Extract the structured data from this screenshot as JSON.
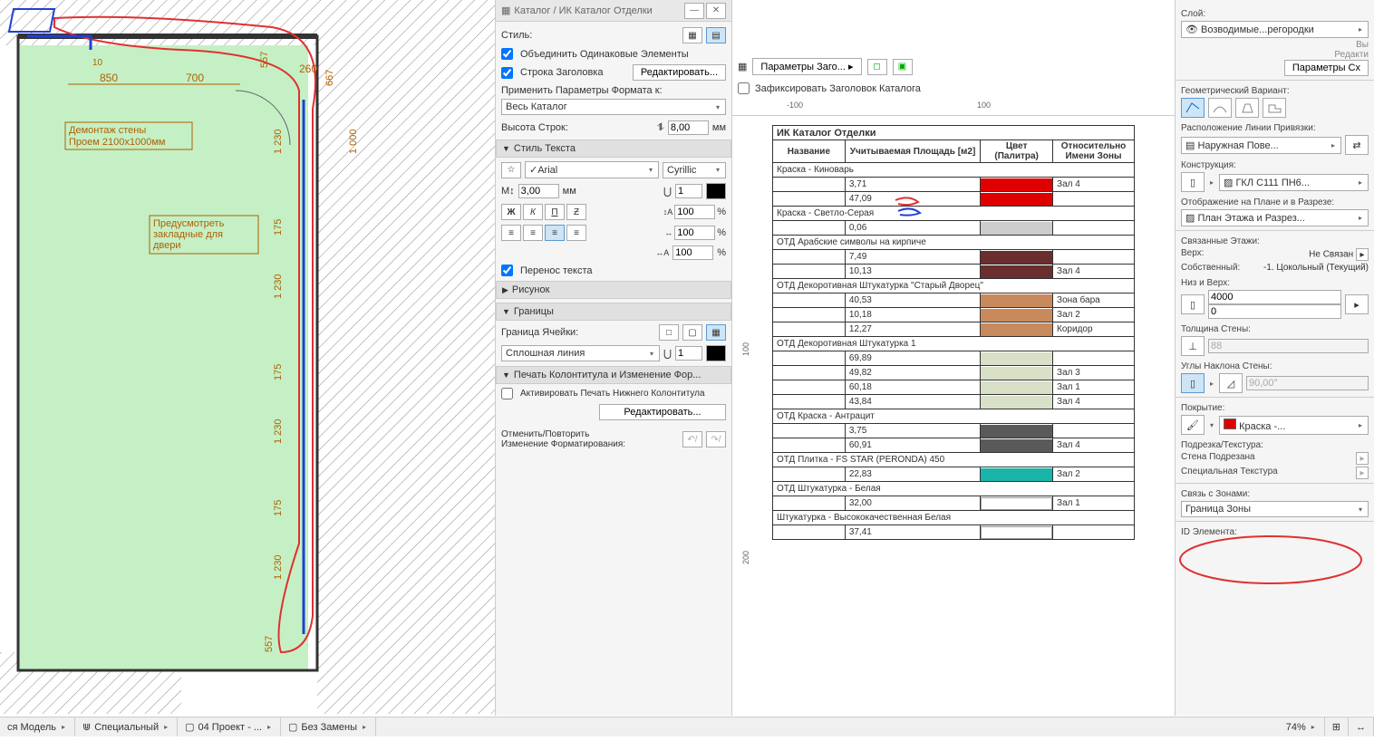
{
  "plan": {
    "note1_line1": "Демонтаж стены",
    "note1_line2": "Проем 2100х1000мм",
    "note2_line1": "Предусмотреть",
    "note2_line2": "закладные для",
    "note2_line3": "двери",
    "dims": {
      "d850": "850",
      "d700": "700",
      "d260": "260",
      "d10": "10",
      "d557": "557",
      "d667": "667",
      "d1000": "1 000",
      "d1230": "1 230",
      "d175": "175"
    }
  },
  "style_panel": {
    "title": "Каталог / ИК Каталог Отделки",
    "style_label": "Стиль:",
    "merge_same": "Объединить Одинаковые Элементы",
    "header_row": "Строка Заголовка",
    "edit_btn": "Редактировать...",
    "apply_format_label": "Применить Параметры Формата к:",
    "apply_target": "Весь Каталог",
    "row_height_label": "Высота Строк:",
    "row_height_val": "8,00",
    "unit_mm": "мм",
    "sec_text_style": "Стиль Текста",
    "font": "Arial",
    "script": "Cyrillic",
    "font_size": "3,00",
    "leading": "1",
    "spacing_pct": "100",
    "width_pct": "100",
    "height_pct": "100",
    "wrap_text": "Перенос текста",
    "sec_image": "Рисунок",
    "sec_borders": "Границы",
    "cell_border_label": "Граница Ячейки:",
    "line_type": "Сплошная линия",
    "pen_val": "1",
    "sec_footer": "Печать Колонтитула и Изменение Фор...",
    "activate_footer": "Активировать Печать Нижнего Колонтитула",
    "edit_btn2": "Редактировать...",
    "undo_redo_label1": "Отменить/Повторить",
    "undo_redo_label2": "Изменение Форматирования:"
  },
  "catalog": {
    "params_btn": "Параметры Заго...",
    "lock_header": "Зафиксировать Заголовок Каталога",
    "ruler_neg100": "-100",
    "ruler_100": "100",
    "ruler_200": "200",
    "title": "ИК Каталог Отделки",
    "col_name": "Название",
    "col_area": "Учитываемая Площадь [м2]",
    "col_color": "Цвет (Палитра)",
    "col_zone": "Относительно Имени Зоны",
    "rows": [
      {
        "type": "group",
        "name": "Краска - Киноварь"
      },
      {
        "type": "data",
        "area": "3,71",
        "color": "#e00000",
        "zone": "Зал 4"
      },
      {
        "type": "data",
        "area": "47,09",
        "color": "#e00000",
        "zone": ""
      },
      {
        "type": "group",
        "name": "Краска - Светло-Серая"
      },
      {
        "type": "data",
        "area": "0,06",
        "color": "#cccccc",
        "zone": ""
      },
      {
        "type": "group",
        "name": "ОТД Арабские символы на кирпиче"
      },
      {
        "type": "data",
        "area": "7,49",
        "color": "#6b2e2e",
        "zone": ""
      },
      {
        "type": "data",
        "area": "10,13",
        "color": "#6b2e2e",
        "zone": "Зал 4"
      },
      {
        "type": "group",
        "name": "ОТД Декоротивная Штукатурка \"Старый Дворец\""
      },
      {
        "type": "data",
        "area": "40,53",
        "color": "#c88a5c",
        "zone": "Зона бара"
      },
      {
        "type": "data",
        "area": "10,18",
        "color": "#c88a5c",
        "zone": "Зал 2"
      },
      {
        "type": "data",
        "area": "12,27",
        "color": "#c88a5c",
        "zone": "Коридор"
      },
      {
        "type": "group",
        "name": "ОТД Декоротивная Штукатурка 1"
      },
      {
        "type": "data",
        "area": "69,89",
        "color": "#d8e0c8",
        "zone": ""
      },
      {
        "type": "data",
        "area": "49,82",
        "color": "#d8e0c8",
        "zone": "Зал 3"
      },
      {
        "type": "data",
        "area": "60,18",
        "color": "#d8e0c8",
        "zone": "Зал 1"
      },
      {
        "type": "data",
        "area": "43,84",
        "color": "#d8e0c8",
        "zone": "Зал 4"
      },
      {
        "type": "group",
        "name": "ОТД Краска - Антрацит"
      },
      {
        "type": "data",
        "area": "3,75",
        "color": "#5a5a5a",
        "zone": ""
      },
      {
        "type": "data",
        "area": "60,91",
        "color": "#5a5a5a",
        "zone": "Зал 4"
      },
      {
        "type": "group",
        "name": "ОТД Плитка - FS STAR (PERONDA) 450"
      },
      {
        "type": "data",
        "area": "22,83",
        "color": "#1ab5a8",
        "zone": "Зал 2"
      },
      {
        "type": "group",
        "name": "ОТД Штукатурка - Белая"
      },
      {
        "type": "data",
        "area": "32,00",
        "color": "#ffffff",
        "zone": "Зал 1"
      },
      {
        "type": "group",
        "name": "Штукатурка - Высококачественная Белая"
      },
      {
        "type": "data",
        "area": "37,41",
        "color": "#ffffff",
        "zone": ""
      }
    ]
  },
  "props": {
    "layer_label": "Слой:",
    "layer_value": "Возводимые...регородки",
    "geom_label": "Геометрический Вариант:",
    "refline_label": "Расположение Линии Привязки:",
    "refline_value": "Наружная Пове...",
    "construction_label": "Конструкция:",
    "construction_value": "ГКЛ С111 ПН6...",
    "display_label": "Отображение на Плане и в Разрезе:",
    "display_value": "План Этажа и Разрез...",
    "linked_label": "Связанные Этажи:",
    "top_label": "Верх:",
    "top_value": "Не Связан",
    "own_label": "Собственный:",
    "own_value": "-1. Цокольный (Текущий)",
    "bottop_label": "Низ и Верх:",
    "height_top": "4000",
    "height_bot": "0",
    "thickness_label": "Толщина Стены:",
    "thickness_value": "88",
    "slant_label": "Углы Наклона Стены:",
    "slant_value": "90,00°",
    "cover_label": "Покрытие:",
    "cover_value": "Краска -...",
    "cover_color": "#e00000",
    "trim_label": "Подрезка/Текстура:",
    "trim_wall": "Стена Подрезана",
    "trim_texture": "Специальная Текстура",
    "zones_label": "Связь с Зонами:",
    "zones_value": "Граница Зоны",
    "elem_id_label": "ID Элемента:",
    "params_btn": "Параметры Сх",
    "v_label": "Вы",
    "edit_label": "Редакти"
  },
  "status": {
    "model": "ся Модель",
    "special": "Специальный",
    "project": "04 Проект - ...",
    "replace": "Без Замены",
    "zoom": "74%"
  }
}
